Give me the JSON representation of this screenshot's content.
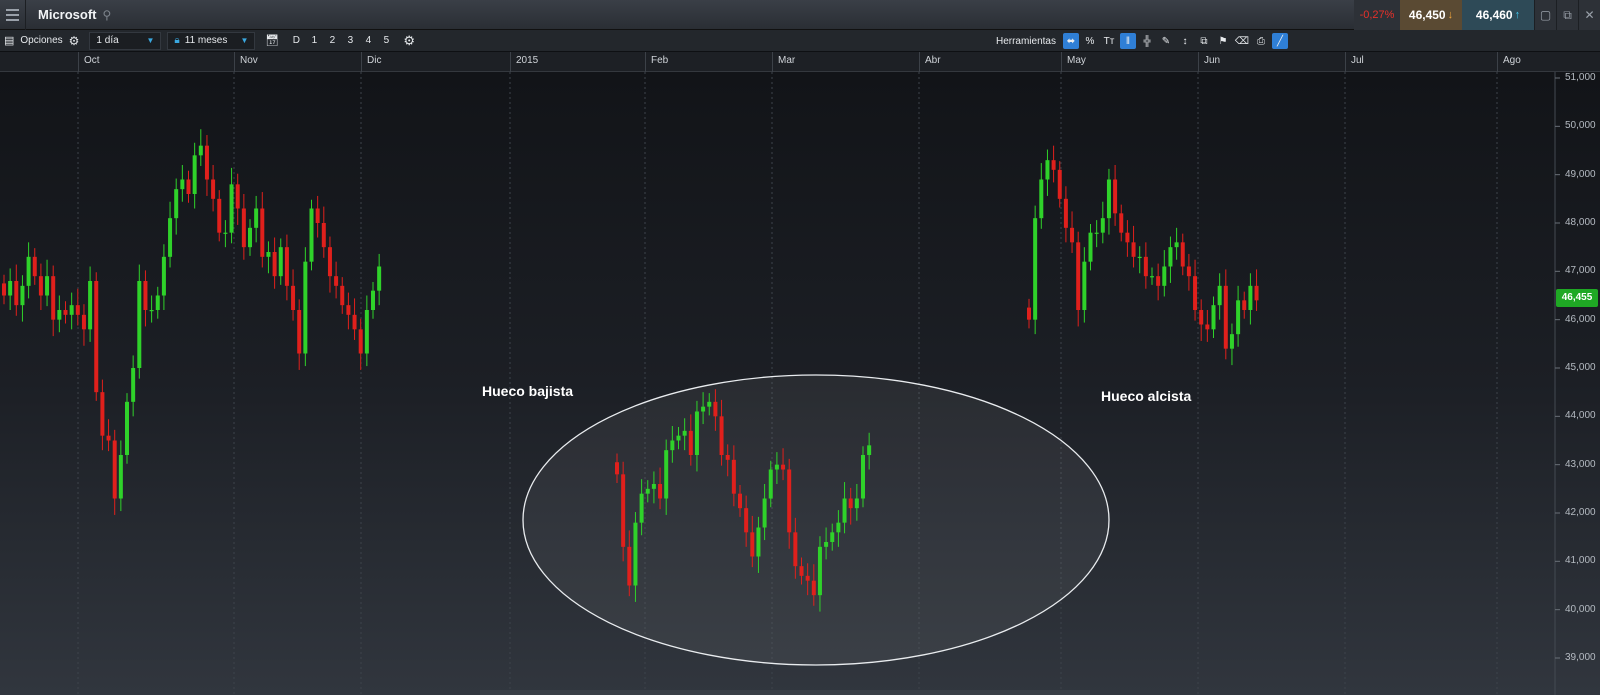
{
  "window": {
    "title": "Microsoft",
    "change_pct": "-0,27%",
    "bid": "46,450",
    "ask": "46,460",
    "bid_arrow": "↓",
    "ask_arrow": "↑"
  },
  "toolbar": {
    "options_label": "Opciones",
    "interval_value": "1 día",
    "range_value": "11 meses",
    "periods": [
      "D",
      "1",
      "2",
      "3",
      "4",
      "5"
    ],
    "tools_label": "Herramientas"
  },
  "colors": {
    "up": "#2fd22a",
    "down": "#e0201c",
    "annotation_ellipse": "#e9ecef"
  },
  "icons": [
    "menu-icon",
    "search-icon",
    "gear-icon",
    "calendar-icon",
    "lock-icon",
    "minimize-icon",
    "restore-icon",
    "close-icon"
  ],
  "chart_data": {
    "type": "candlestick",
    "instrument": "Microsoft",
    "months": [
      "Oct",
      "Nov",
      "Dic",
      "2015",
      "Feb",
      "Mar",
      "Abr",
      "May",
      "Jun",
      "Jul",
      "Ago"
    ],
    "ylim": [
      38800,
      51200
    ],
    "y_ticks": [
      "51,000",
      "50,000",
      "49,000",
      "48,000",
      "47,000",
      "46,000",
      "45,000",
      "44,000",
      "43,000",
      "42,000",
      "41,000",
      "40,000",
      "39,000"
    ],
    "y_tick_values": [
      51000,
      50000,
      49000,
      48000,
      47000,
      46000,
      45000,
      44000,
      43000,
      42000,
      41000,
      40000,
      39000
    ],
    "last_price": "46,455",
    "last_price_value": 46455,
    "annotations": [
      {
        "text": "Hueco bajista"
      },
      {
        "text": "Hueco alcista"
      }
    ],
    "segments": [
      {
        "start": "Oct",
        "candles": [
          46500,
          46800,
          46300,
          46700,
          47300,
          46900,
          46500,
          46900,
          46000,
          46200,
          46100,
          46300,
          46100,
          45800,
          46800,
          44500,
          43600,
          43500,
          42300,
          43200,
          44300,
          45000,
          46800,
          46200,
          46200,
          46500,
          47300,
          48100,
          48700,
          48900,
          48600,
          49400,
          49600,
          48900,
          48500,
          47800,
          47800,
          48800,
          48300,
          47500,
          47900,
          48300,
          47300,
          47400,
          46900,
          47500,
          46700,
          46200,
          45300,
          47200,
          48300,
          48000,
          47500,
          46900,
          46700,
          46300,
          46100,
          45800,
          45300,
          46200,
          46600,
          47100
        ]
      },
      {
        "start": "Feb",
        "candles": [
          42800,
          41300,
          40500,
          41800,
          42400,
          42500,
          42600,
          42300,
          43300,
          43500,
          43600,
          43700,
          43200,
          44100,
          44200,
          44300,
          44000,
          43200,
          43100,
          42400,
          42100,
          41600,
          41100,
          41700,
          42300,
          42900,
          43000,
          42900,
          41600,
          40900,
          40700,
          40600,
          40300,
          41300,
          41400,
          41600,
          41800,
          42300,
          42100,
          42300,
          43200,
          43400
        ]
      },
      {
        "start": "Abr",
        "candles": [
          46000,
          48100,
          48900,
          49300,
          49100,
          48500,
          47900,
          47600,
          46200,
          47200,
          47800,
          47800,
          48100,
          48900,
          48200,
          47800,
          47600,
          47300,
          47300,
          46900,
          46900,
          46700,
          47100,
          47500,
          47600,
          47100,
          46900,
          46200,
          45900,
          45800,
          46300,
          46700,
          45400,
          45700,
          46400,
          46200,
          46700,
          46400
        ]
      }
    ]
  }
}
